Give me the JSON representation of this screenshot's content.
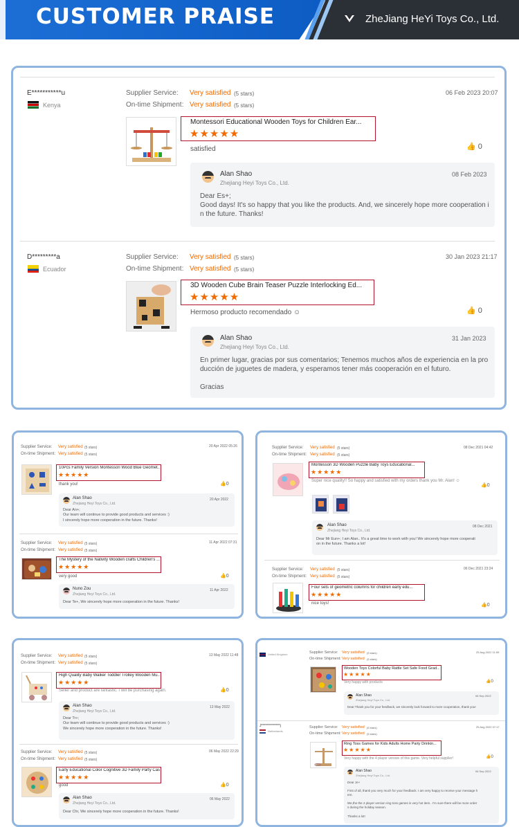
{
  "banner": {
    "title": "CUSTOMER PRAISE",
    "company": "ZheJiang HeYi Toys Co., Ltd."
  },
  "labels": {
    "supplier": "Supplier Service:",
    "shipment": "On-time Shipment:",
    "satisfied": "Very satisfied",
    "five": "(5 stars)"
  },
  "main": [
    {
      "name": "E***********u",
      "country": "Kenya",
      "date": "06 Feb 2023 20:07",
      "product": "Montessori Educational Wooden Toys for Children Ear...",
      "comment": "satisfied",
      "likes": "0",
      "reply": {
        "name": "Alan Shao",
        "company": "Zhejiang Heyi Toys Co., Ltd.",
        "date": "08 Feb 2023",
        "text": "Dear Es+;\nGood days! It's so happy that you like the products. And, we sincerely hope more cooperation i\nn the future. Thanks!"
      }
    },
    {
      "name": "D*********a",
      "country": "Ecuador",
      "date": "30 Jan 2023 21:17",
      "product": "3D Wooden Cube Brain Teaser Puzzle Interlocking Ed...",
      "comment": "Hermoso producto recomendado ☺",
      "likes": "0",
      "reply": {
        "name": "Alan Shao",
        "company": "Zhejiang Heyi Toys Co., Ltd.",
        "date": "31 Jan 2023",
        "text": "En primer lugar, gracias por sus comentarios; Tenemos muchos años de experiencia en la pro\nducción de juguetes de madera, y esperamos tener más cooperación en el futuro.\n\nGracias"
      }
    }
  ],
  "p2": [
    {
      "date": "20 Apr 2022 05:26",
      "product": "10Pcs Family Version Montessori Wood Blue Geomet...",
      "comment": "thank you!",
      "likes": "0",
      "reply": {
        "name": "Alan Shao",
        "company": "Zhejiang Heyi Toys Co., Ltd.",
        "date": "20 Apr 2022",
        "text": "Dear An+;\nOur team will continue to provide good products and services :)\nI sincerely hope more cooperation in the future. Thanks!"
      }
    },
    {
      "date": "11 Apr 2022 07:31",
      "product": "The Mystery of the Nativity Wooden crafts Children's ...",
      "comment": "very good",
      "likes": "0",
      "reply": {
        "name": "Nuno Zou",
        "company": "Zhejiang Heyi Toys Co., Ltd.",
        "date": "11 Apr 2022",
        "text": "Dear Te+, We sincerely hope more cooperation in the future. Thanks!"
      }
    }
  ],
  "p3": [
    {
      "date": "08 Dec 2021 04:42",
      "product": "Montessori 3D Wooden Puzzle Baby Toys Educational...",
      "comment": "Super nice quality!! So happy and satisfied with my orders thank you Mr. Alan! ☺",
      "likes": "0",
      "reply": {
        "name": "Alan Shao",
        "company": "Zhejiang Heyi Toys Co., Ltd.",
        "date": "08 Dec 2021",
        "text": "Dear Mr Eun+; I am Alan.. It's a great time to work with you! We sincerely hope more cooperati\non in the future. Thanks a lot!"
      }
    },
    {
      "date": "06 Dec 2021 23:24",
      "product": "Four sets of geometric columns for children early edu...",
      "comment": "nice toys!",
      "likes": "0"
    }
  ],
  "p4": [
    {
      "date": "13 May 2022 11:48",
      "product": "High Quality Baby Walker Toddler Trolley Wooden Mu...",
      "comment": "Seller and product are fantastic. I will be purchasing again.",
      "likes": "0",
      "reply": {
        "name": "Alan Shao",
        "company": "Zhejiang Heyi Toys Co., Ltd.",
        "date": "13 May 2022",
        "text": "Dear Tr+;\nOur team will continue to provide good products and services :)\nWe sincerely hope more cooperation in the future. Thanks!"
      }
    },
    {
      "date": "06 May 2022 22:29",
      "product": "Early Educational Color Cognitive 3D Family Party Cas...",
      "comment": "good",
      "likes": "0",
      "reply": {
        "name": "Alan Shao",
        "company": "Zhejiang Heyi Toys Co., Ltd.",
        "date": "06 May 2022",
        "text": "Dear Chr, We sincerely hope more cooperation in the future. Thanks!"
      }
    }
  ],
  "p5": [
    {
      "country": "United Kingdom",
      "date": "25 Aug 2022 11:59",
      "product": "Wooden Toys Colorful Baby Rattle Set Safe Food Grad...",
      "comment": "Very happy with products",
      "likes": "0",
      "reply": {
        "name": "Alan Shao",
        "company": "Zhejiang Heyi Toys Co., Ltd.",
        "date": "06 Sep 2022",
        "text": "Dear:Thank you for your feedback, we sincerely look forward to more cooperation, thank you!"
      }
    },
    {
      "name": "J**************j",
      "country": "Netherlands",
      "date": "25 Aug 2022 07:17",
      "product": "Ring Toss Games for Kids Adults Home Party Drinkin...",
      "comment": "Very happy with the 4 player version of this game. Very helpful supplier!",
      "likes": "0",
      "reply": {
        "name": "Alan Shao",
        "company": "Zhejiang Heyi Toys Co., Ltd.",
        "date": "06 Sep 2022",
        "text": "Dear Je+\n\nFirst of all, thank you very much for your feedback. I am very happy to receive your message h\nere.\n\nWe,the the 4 player version ring toss games is very hot item.. I'm sure there will be more order\ns during the holiday season.\n\nThanks a lot!"
      }
    }
  ]
}
